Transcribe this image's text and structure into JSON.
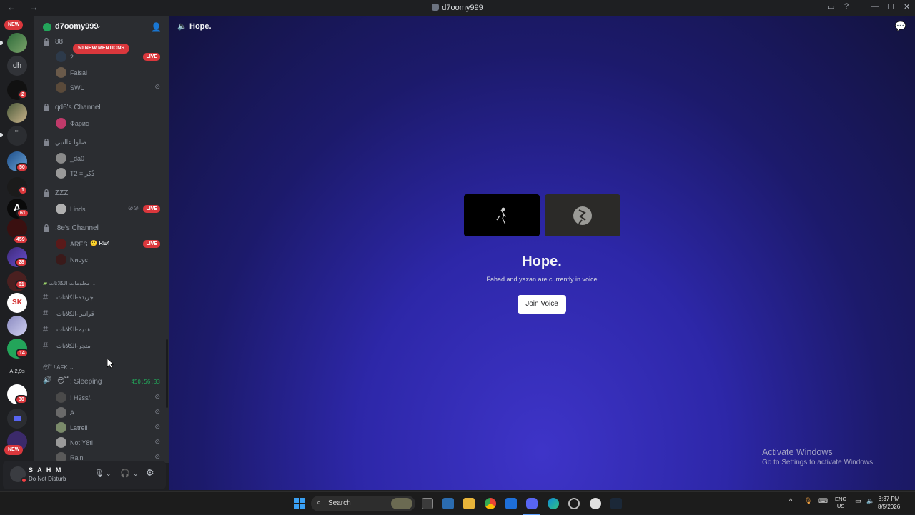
{
  "window": {
    "title": "d7oomy999",
    "nav_label": "← →",
    "controls": {
      "inbox_icon": "inbox-icon",
      "help_icon": "help-icon",
      "minimize": "—",
      "maximize": "☐",
      "close": "✕"
    }
  },
  "rail": {
    "new_top": "NEW",
    "new_bottom": "NEW",
    "dh_label": "dh",
    "a29s_label": "A,2,9s",
    "quote_label": "\"\"",
    "badges": [
      "2",
      "50",
      "1",
      "61",
      "459",
      "28",
      "61",
      "14",
      "30"
    ]
  },
  "sidebar": {
    "server_name": "d7oomy999",
    "mentions_pill": "50 NEW MENTIONS",
    "channels": {
      "c88": {
        "name": "88",
        "members": [
          {
            "name": "2",
            "live": "LIVE"
          },
          {
            "name": "Faisal"
          },
          {
            "name": "SWL"
          }
        ]
      },
      "qd6": {
        "name": "qd6's Channel",
        "members": [
          {
            "name": "Фарис"
          }
        ]
      },
      "salu": {
        "name": "صلوا عالنبي",
        "members": [
          {
            "name": "_da0"
          },
          {
            "name": "T2 = ذُكر"
          }
        ]
      },
      "zzz": {
        "name": "ZZZ",
        "members": [
          {
            "name": "Linds",
            "live": "LIVE"
          }
        ]
      },
      "eight": {
        "name": ".8e's Channel",
        "members": [
          {
            "name": "ARES",
            "tag": "RE4",
            "live": "LIVE"
          },
          {
            "name": "Nисус"
          }
        ]
      }
    },
    "category_info": "معلومات الكلانات",
    "text_channels": [
      "جريدة-الكلانات",
      "قوانين-الكلانات",
      "تقديم-الكلانات",
      "متجر-الكلانات"
    ],
    "category_afk": "AFK",
    "afk_channel": {
      "name": "! Sleeping",
      "timer": "450:56:33",
      "members": [
        "! H2ss/.",
        "A",
        "Latrell",
        "Not Y8tl",
        "Rain"
      ]
    }
  },
  "user": {
    "name": "S A H M",
    "status": "Do Not Disturb"
  },
  "main": {
    "channel_title": "Hope.",
    "voice_title": "Hope.",
    "voice_subtitle": "Fahad and yazan are currently in voice",
    "join_label": "Join Voice"
  },
  "watermark": {
    "line1": "Activate Windows",
    "line2": "Go to Settings to activate Windows."
  },
  "taskbar": {
    "search_placeholder": "Search",
    "lang1": "ENG",
    "lang2": "US",
    "time": "8:37 PM",
    "date": "8/5/2026"
  },
  "colors": {
    "live_red": "#da373c",
    "online_green": "#23a55a",
    "voice_bg": "#2d27a8"
  }
}
